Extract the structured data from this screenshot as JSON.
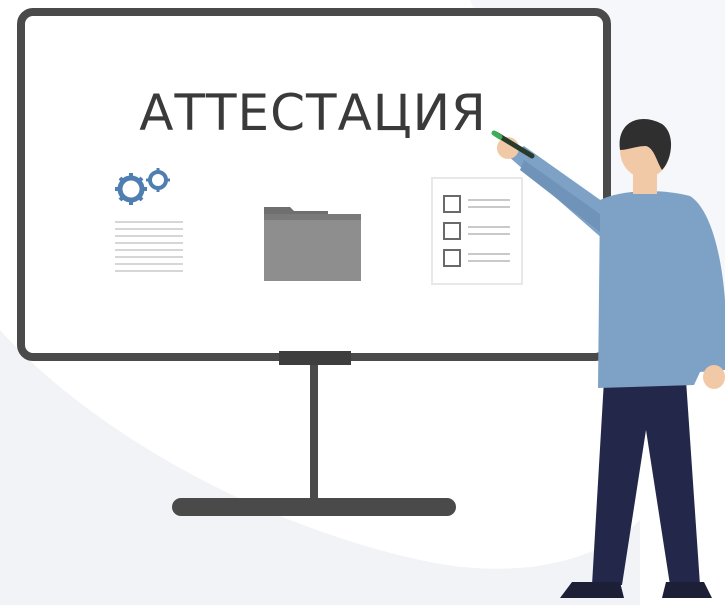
{
  "board": {
    "title": "АТТЕСТАЦИЯ"
  },
  "colors": {
    "board_frame": "#4a4a4a",
    "board_fill": "#ffffff",
    "title_text": "#3a3a3a",
    "gear": "#4f7fb0",
    "folder": "#8e8e8e",
    "checklist_line": "#c9c9c9",
    "shirt": "#7ea2c6",
    "trousers": "#23284a",
    "hair": "#2f2f2f",
    "skin": "#f2c9a7",
    "background_blob": "#f2f3f7"
  },
  "icons": [
    "gears-icon",
    "folder-icon",
    "checklist-icon",
    "marker-icon"
  ]
}
